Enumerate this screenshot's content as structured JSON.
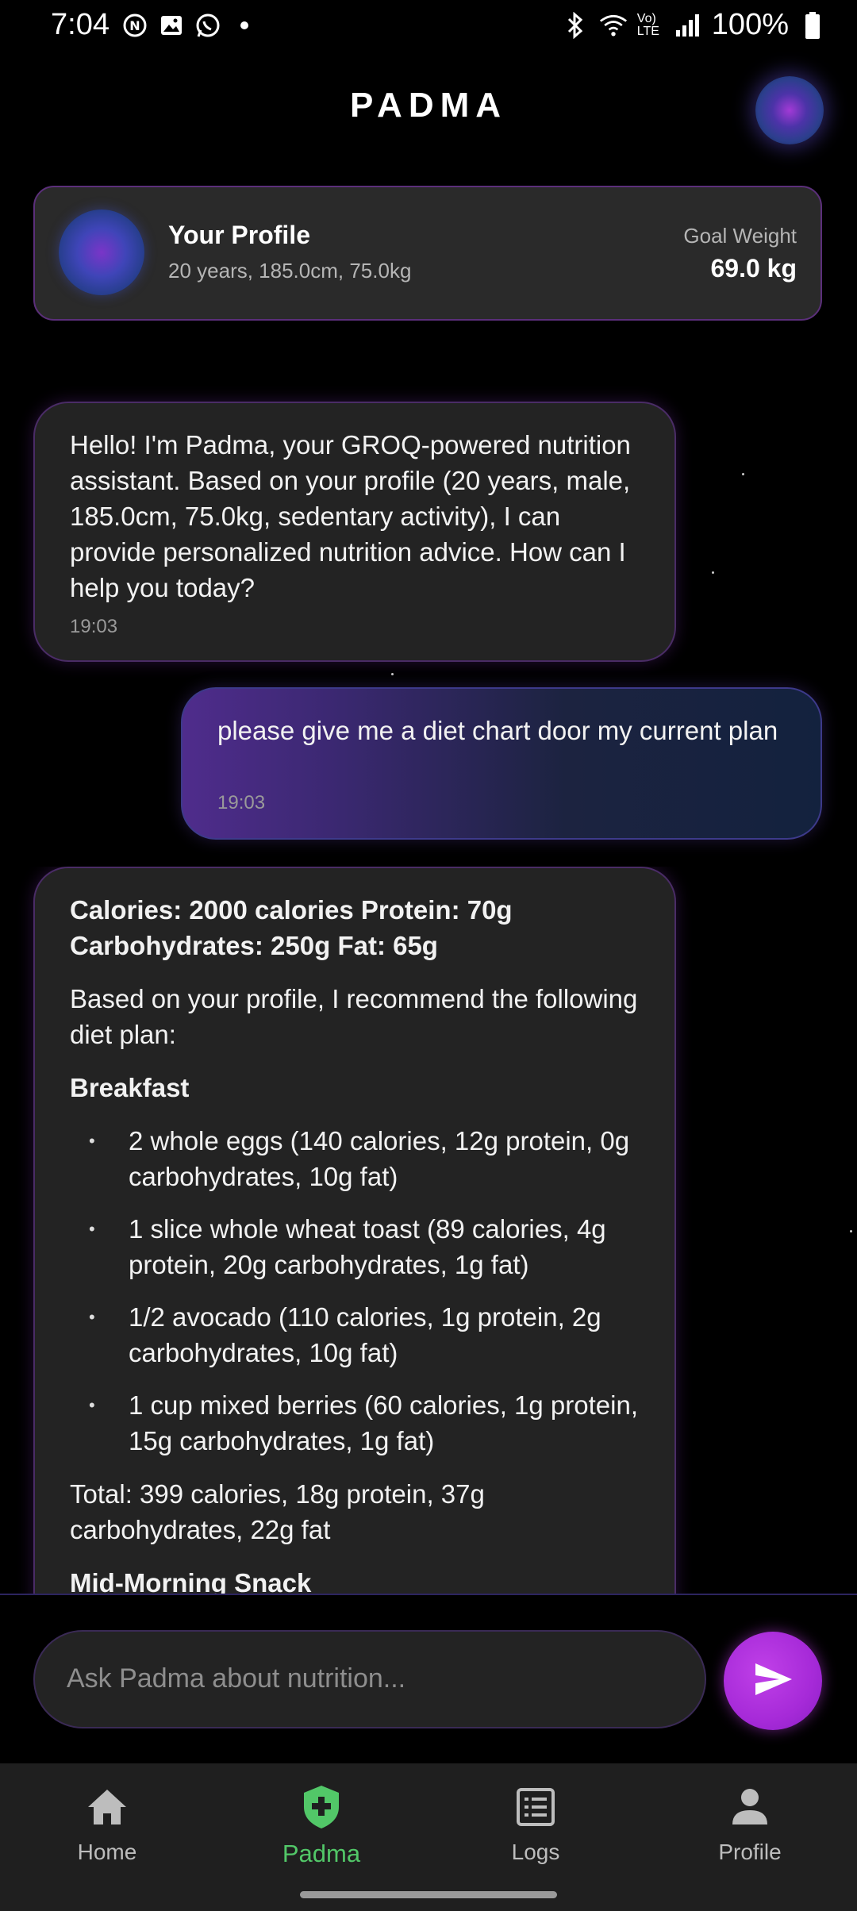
{
  "status_bar": {
    "time": "7:04",
    "notification_icons": [
      "nfc-icon",
      "gallery-icon",
      "whatsapp-icon",
      "dot-icon"
    ],
    "system_icons": [
      "bluetooth-icon",
      "wifi-icon",
      "volte-icon",
      "signal-icon",
      "battery-icon"
    ],
    "volte_text": "Vo) LTE",
    "battery": "100%"
  },
  "header": {
    "title": "PADMA"
  },
  "profile": {
    "title": "Your Profile",
    "details": "20 years, 185.0cm, 75.0kg",
    "goal_label": "Goal Weight",
    "goal_value": "69.0 kg"
  },
  "messages": [
    {
      "sender": "assistant",
      "text": "Hello! I'm Padma, your GROQ-powered nutrition assistant. Based on your profile (20 years, male, 185.0cm, 75.0kg, sedentary activity), I can provide personalized nutrition advice. How can I help you today?",
      "time": "19:03"
    },
    {
      "sender": "user",
      "text": "please give me a diet chart door my current plan",
      "time": "19:03"
    },
    {
      "sender": "assistant",
      "summary": "Calories: 2000 calories Protein: 70g Carbohydrates: 250g Fat: 65g",
      "intro": "Based on your profile, I recommend the following diet plan:",
      "section1_title": "Breakfast",
      "section1_items": [
        "2 whole eggs (140 calories, 12g protein, 0g carbohydrates, 10g fat)",
        "1 slice whole wheat toast (89 calories, 4g protein, 20g carbohydrates, 1g fat)",
        "1/2 avocado (110 calories, 1g protein, 2g carbohydrates, 10g fat)",
        "1 cup mixed berries (60 calories, 1g protein, 15g carbohydrates, 1g fat)"
      ],
      "section1_total": "Total: 399 calories, 18g protein, 37g carbohydrates, 22g fat",
      "section2_title": "Mid-Morning Snack"
    }
  ],
  "input": {
    "placeholder": "Ask Padma about nutrition..."
  },
  "nav": {
    "items": [
      {
        "label": "Home",
        "icon": "home-icon"
      },
      {
        "label": "Padma",
        "icon": "shield-plus-icon",
        "active": true
      },
      {
        "label": "Logs",
        "icon": "list-icon"
      },
      {
        "label": "Profile",
        "icon": "person-icon"
      }
    ]
  },
  "colors": {
    "background": "#000000",
    "card": "#2a2a2a",
    "accent_purple": "#a62ad8",
    "active_nav": "#52c768"
  }
}
